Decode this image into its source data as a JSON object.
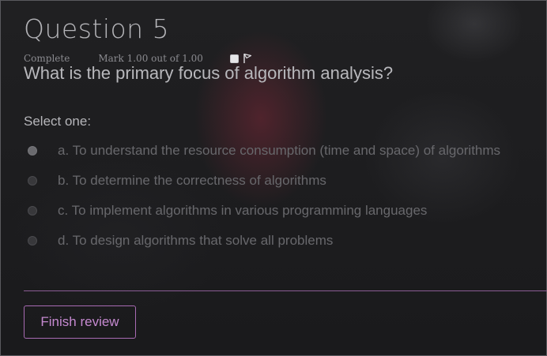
{
  "question": {
    "title": "Question 5",
    "state": "Complete",
    "mark": "Mark 1.00 out of 1.00",
    "flag_icon": "flag-icon",
    "text": "What is the primary focus of algorithm analysis?"
  },
  "answer_block": {
    "prompt": "Select one:",
    "options": [
      {
        "label": "a. To understand the resource consumption (time and space) of algorithms",
        "selected": true
      },
      {
        "label": "b. To determine the correctness of algorithms",
        "selected": false
      },
      {
        "label": "c. To implement algorithms in various programming languages",
        "selected": false
      },
      {
        "label": "d. To design algorithms that solve all problems",
        "selected": false
      }
    ]
  },
  "footer": {
    "finish_label": "Finish review"
  },
  "colors": {
    "accent": "#c589d0",
    "divider": "#8a5c94"
  }
}
